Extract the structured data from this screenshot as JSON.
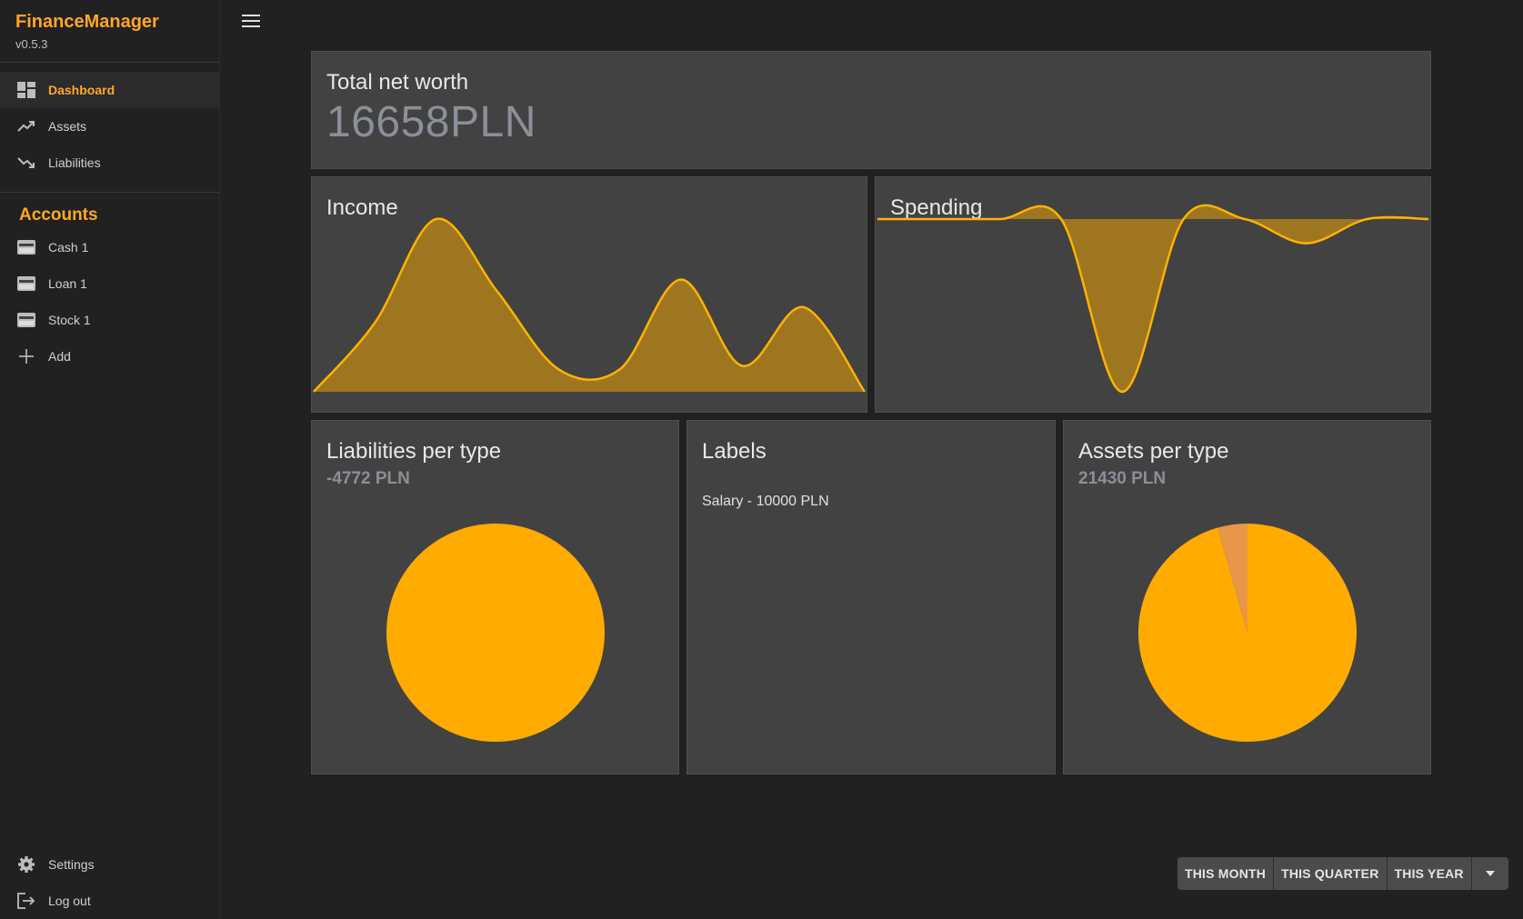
{
  "app": {
    "title": "FinanceManager",
    "version": "v0.5.3"
  },
  "nav": [
    {
      "label": "Dashboard",
      "icon": "dashboard-icon",
      "active": true
    },
    {
      "label": "Assets",
      "icon": "trending-up-icon"
    },
    {
      "label": "Liabilities",
      "icon": "trending-down-icon"
    }
  ],
  "accounts": {
    "heading": "Accounts",
    "items": [
      {
        "label": "Cash 1",
        "icon": "card-icon"
      },
      {
        "label": "Loan 1",
        "icon": "card-icon"
      },
      {
        "label": "Stock 1",
        "icon": "card-icon"
      }
    ],
    "add_label": "Add"
  },
  "bottom_nav": {
    "settings_label": "Settings",
    "logout_label": "Log out"
  },
  "net_worth": {
    "title": "Total net worth",
    "value": "16658PLN"
  },
  "income": {
    "title": "Income"
  },
  "spending": {
    "title": "Spending"
  },
  "liabilities": {
    "title": "Liabilities per type",
    "total": "-4772 PLN"
  },
  "labels": {
    "title": "Labels",
    "items": [
      "Salary - 10000 PLN"
    ]
  },
  "assets": {
    "title": "Assets per type",
    "total": "21430 PLN"
  },
  "range": {
    "this_month": "THIS MONTH",
    "this_quarter": "THIS QUARTER",
    "this_year": "THIS YEAR"
  },
  "colors": {
    "accent": "#ffa726",
    "chart_fill": "#9e7620",
    "chart_line": "#ffb300",
    "pie_main": "#ffab00",
    "pie_second": "#e8964a"
  },
  "chart_data": [
    {
      "type": "area",
      "name": "income",
      "values": [
        0,
        40,
        100,
        58,
        13,
        13,
        65,
        15,
        49,
        0
      ]
    },
    {
      "type": "area",
      "name": "spending",
      "values": [
        0,
        0,
        0,
        0,
        -100,
        0,
        0,
        -14,
        0,
        0
      ]
    },
    {
      "type": "pie",
      "name": "liabilities-per-type",
      "values": [
        100
      ]
    },
    {
      "type": "pie",
      "name": "assets-per-type",
      "values": [
        95.6,
        4.4
      ]
    }
  ]
}
